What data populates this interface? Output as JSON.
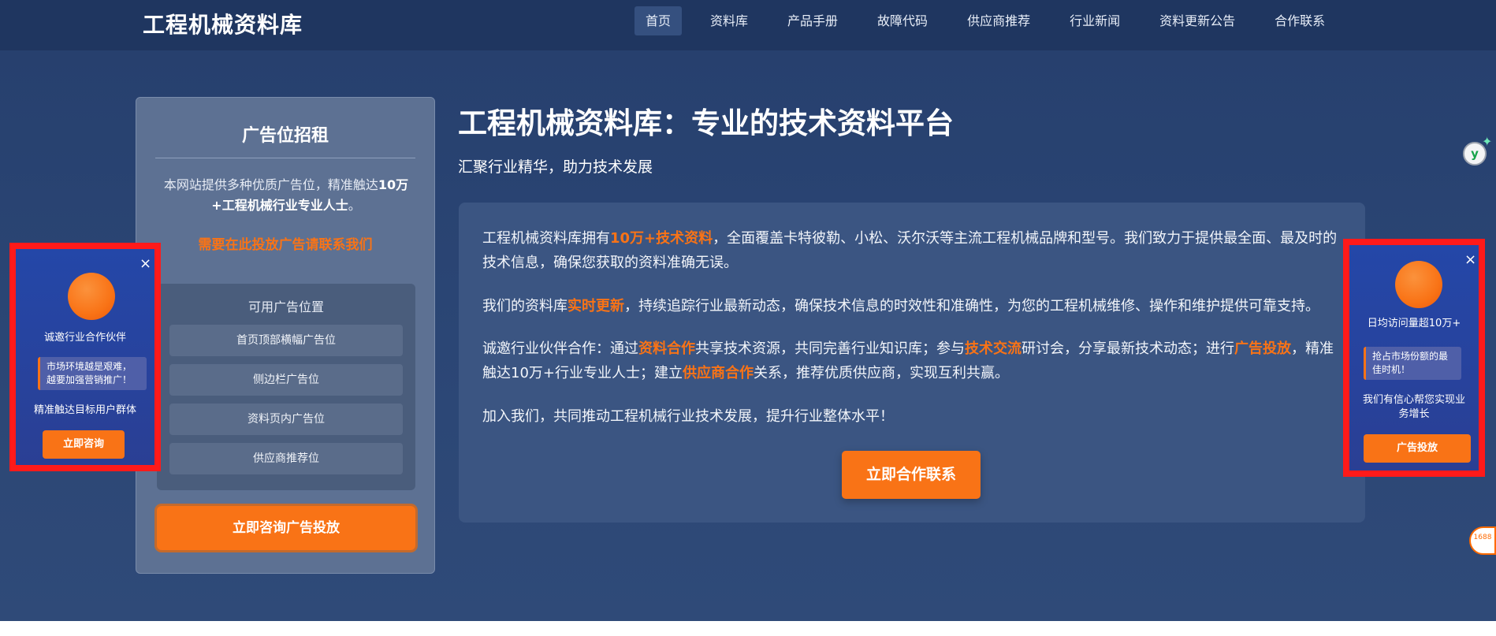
{
  "site": {
    "logo": "工程机械资料库"
  },
  "nav": {
    "items": [
      {
        "label": "首页",
        "active": true
      },
      {
        "label": "资料库"
      },
      {
        "label": "产品手册"
      },
      {
        "label": "故障代码"
      },
      {
        "label": "供应商推荐"
      },
      {
        "label": "行业新闻"
      },
      {
        "label": "资料更新公告"
      },
      {
        "label": "合作联系"
      }
    ]
  },
  "sidebar_ad": {
    "title": "广告位招租",
    "desc_prefix": "本网站提供多种优质广告位，精准触达",
    "desc_bold": "10万+工程机械行业专业人士",
    "desc_suffix": "。",
    "contact": "需要在此投放广告请联系我们",
    "positions_title": "可用广告位置",
    "positions": [
      "首页顶部横幅广告位",
      "侧边栏广告位",
      "资料页内广告位",
      "供应商推荐位"
    ],
    "button": "立即咨询广告投放"
  },
  "hero": {
    "title": "工程机械资料库：专业的技术资料平台",
    "subtitle": "汇聚行业精华，助力技术发展"
  },
  "content": {
    "p1": {
      "a": "工程机械资料库拥有",
      "hl": "10万+技术资料",
      "b": "，全面覆盖卡特彼勒、小松、沃尔沃等主流工程机械品牌和型号。我们致力于提供最全面、最及时的技术信息，确保您获取的资料准确无误。"
    },
    "p2": {
      "a": "我们的资料库",
      "hl": "实时更新",
      "b": "，持续追踪行业最新动态，确保技术信息的时效性和准确性，为您的工程机械维修、操作和维护提供可靠支持。"
    },
    "p3": {
      "a": "诚邀行业伙伴合作：通过",
      "hl1": "资料合作",
      "b": "共享技术资源，共同完善行业知识库；参与",
      "hl2": "技术交流",
      "c": "研讨会，分享最新技术动态；进行",
      "hl3": "广告投放",
      "d": "，精准触达10万+行业专业人士；建立",
      "hl4": "供应商合作",
      "e": "关系，推荐优质供应商，实现互利共赢。"
    },
    "p4": "加入我们，共同推动工程机械行业技术发展，提升行业整体水平！",
    "button": "立即合作联系"
  },
  "popup_left": {
    "close": "×",
    "title": "诚邀行业合作伙伴",
    "box": "市场环境越是艰难，越要加强营销推广！",
    "line": "精准触达目标用户群体",
    "button": "立即咨询"
  },
  "popup_right": {
    "close": "×",
    "title": "日均访问量超10万+",
    "box": "抢占市场份额的最佳时机！",
    "line": "我们有信心帮您实现业务增长",
    "button": "广告投放"
  },
  "edge_icons": {
    "y_icon": "y",
    "spark": "✦",
    "ali_label": "1688"
  },
  "colors": {
    "accent": "#f97316",
    "nav_bg": "#1f3660",
    "page_bg": "#2b4675",
    "popup_border": "#ff1a1a"
  }
}
